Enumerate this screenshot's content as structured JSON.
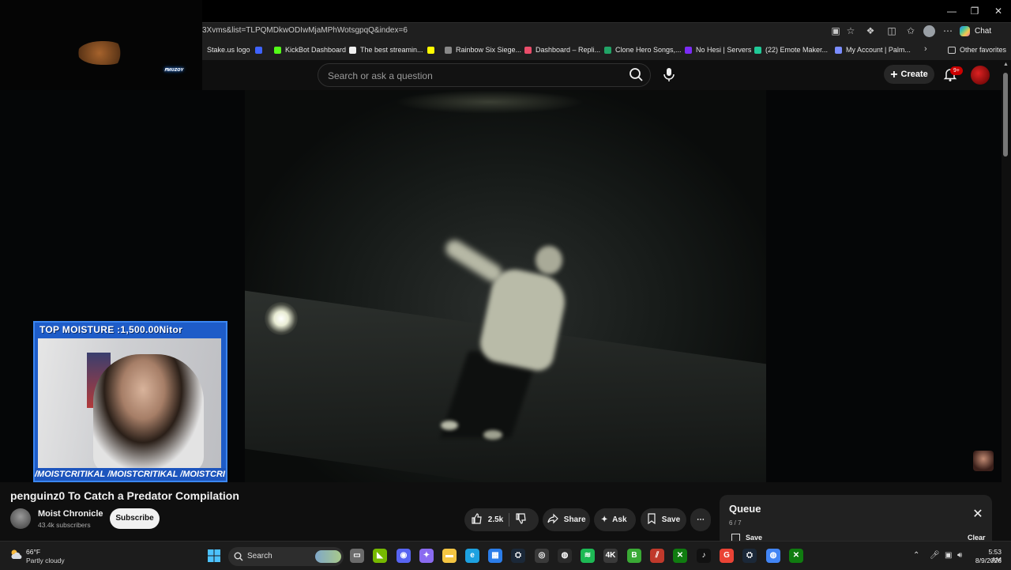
{
  "browser": {
    "url": "3Xvms&list=TLPQMDkwODIwMjaMPhWotsgpqQ&index=6",
    "chat_label": "Chat",
    "other_favorites": "Other favorites",
    "bookmarks": [
      {
        "label": "Stake.us logo",
        "color": "#1f1f1f"
      },
      {
        "label": "",
        "color": "#3f63ff"
      },
      {
        "label": "KickBot Dashboard",
        "color": "#53fc18"
      },
      {
        "label": "The best streamin...",
        "color": "#f0f0f0"
      },
      {
        "label": "",
        "color": "#fffc00"
      },
      {
        "label": "Rainbow Six Siege...",
        "color": "#888888"
      },
      {
        "label": "Dashboard – Repli...",
        "color": "#e94d6a"
      },
      {
        "label": "Clone Hero Songs,...",
        "color": "#21a366"
      },
      {
        "label": "No Hesi | Servers",
        "color": "#7b2cf5"
      },
      {
        "label": "(22) Emote Maker...",
        "color": "#20c997"
      },
      {
        "label": "My Account | Palm...",
        "color": "#7a8cff"
      }
    ]
  },
  "youtube": {
    "search_placeholder": "Search or ask a question",
    "create_label": "Create",
    "notification_count": "9+"
  },
  "overlay": {
    "webcam_top_text": "TOP MOISTURE :1,500.00Nitor",
    "webcam_bottom_text": "/MOISTCRITIKAL /MOISTCRITIKAL /MOISTCRITIKAL",
    "neon_label": "ꜰᴍᴜᴢᴏʏ"
  },
  "video_info": {
    "title": "penguinz0 To Catch a Predator Compilation",
    "channel_name": "Moist Chronicle",
    "subscribers": "43.4k subscribers",
    "subscribe_label": "Subscribe",
    "likes": "2.5k",
    "share_label": "Share",
    "ask_label": "Ask",
    "save_label": "Save"
  },
  "queue": {
    "title": "Queue",
    "count": "6 / 7",
    "save_label": "Save",
    "clear_label": "Clear"
  },
  "taskbar": {
    "weather_temp": "66°F",
    "weather_desc": "Partly cloudy",
    "search_label": "Search",
    "time": "5:53 AM",
    "date": "8/9/2026",
    "apps": [
      {
        "name": "file-explorer-icon",
        "color": "#6b6b6b",
        "glyph": "▭"
      },
      {
        "name": "nvidia-icon",
        "color": "#76b900",
        "glyph": "◣"
      },
      {
        "name": "discord-icon",
        "color": "#5865f2",
        "glyph": "◉"
      },
      {
        "name": "copilot-icon",
        "color": "#8a6bf0",
        "glyph": "✦"
      },
      {
        "name": "folder-icon",
        "color": "#f4c542",
        "glyph": "▬"
      },
      {
        "name": "edge-icon",
        "color": "#1da1e0",
        "glyph": "e"
      },
      {
        "name": "store-icon",
        "color": "#2b7de9",
        "glyph": "▦"
      },
      {
        "name": "steam-icon",
        "color": "#1b2838",
        "glyph": "⛭"
      },
      {
        "name": "recording-icon",
        "color": "#3a3a3a",
        "glyph": "◎"
      },
      {
        "name": "obs-icon",
        "color": "#2b2b2b",
        "glyph": "◍"
      },
      {
        "name": "spotify-icon",
        "color": "#1db954",
        "glyph": "≋"
      },
      {
        "name": "4k-icon",
        "color": "#3a3a3a",
        "glyph": "4K"
      },
      {
        "name": "b-app-icon",
        "color": "#3aaa35",
        "glyph": "B"
      },
      {
        "name": "stream-tool-icon",
        "color": "#c0392b",
        "glyph": "⫽"
      },
      {
        "name": "xbox-icon",
        "color": "#107c10",
        "glyph": "✕"
      },
      {
        "name": "tiktok-icon",
        "color": "#111111",
        "glyph": "♪"
      },
      {
        "name": "g-app-icon",
        "color": "#ea4335",
        "glyph": "G"
      },
      {
        "name": "steam-icon-2",
        "color": "#1b2838",
        "glyph": "⛭"
      },
      {
        "name": "chrome-icon",
        "color": "#4285f4",
        "glyph": "◍"
      },
      {
        "name": "xbox-icon-2",
        "color": "#107c10",
        "glyph": "✕"
      }
    ]
  }
}
